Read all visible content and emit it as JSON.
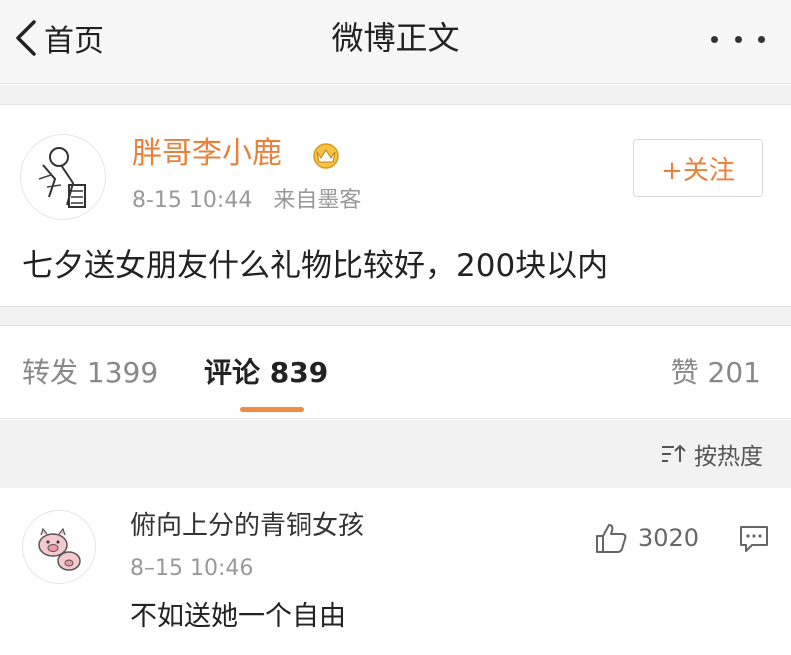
{
  "navbar": {
    "back_label": "首页",
    "title": "微博正文",
    "back_icon": "chevron-left-icon",
    "more_icon": "more-dots-icon"
  },
  "post": {
    "user_name": "胖哥李小鹿",
    "time": "8-15 10:44",
    "source": "来自墨客",
    "follow_label": "+关注",
    "text": "七夕送女朋友什么礼物比较好，200块以内",
    "name_color": "#e8813a"
  },
  "tabs": {
    "repost": "转发 1399",
    "comments": "评论 839",
    "likes": "赞 201",
    "accent": "#f28b44"
  },
  "sort": {
    "label": "按热度",
    "icon": "sort-icon"
  },
  "comment": {
    "user_name": "俯向上分的青铜女孩",
    "time": "8–15 10:46",
    "text": "不如送她一个自由",
    "likes": "3020",
    "like_icon": "thumbs-up-icon",
    "reply_icon": "comment-bubble-icon"
  }
}
